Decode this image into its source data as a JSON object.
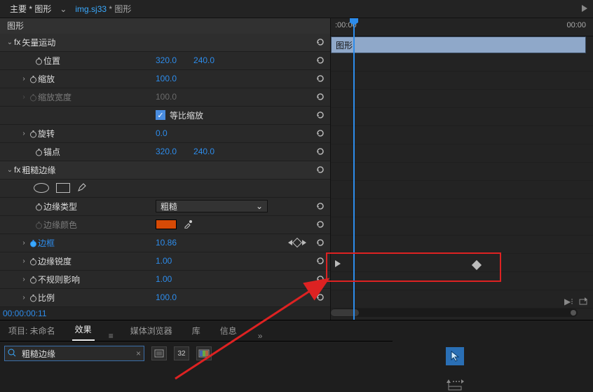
{
  "tabs": {
    "main_prefix": "主要",
    "main_star": "*",
    "main_label": "图形",
    "file_name": "img.sj33",
    "file_suffix": "* 图形"
  },
  "left_header": "图形",
  "timecodes": {
    "t0": ":00:00",
    "t1": "00:00"
  },
  "clip_label": "图形",
  "groups": {
    "vector_motion": "矢量运动",
    "roughen_edges": "粗糙边缘"
  },
  "props": {
    "position": {
      "label": "位置",
      "x": "320.0",
      "y": "240.0"
    },
    "scale": {
      "label": "缩放",
      "v": "100.0"
    },
    "scale_width": {
      "label": "缩放宽度",
      "v": "100.0"
    },
    "uniform": {
      "label": "等比缩放"
    },
    "rotation": {
      "label": "旋转",
      "v": "0.0"
    },
    "anchor": {
      "label": "锚点",
      "x": "320.0",
      "y": "240.0"
    },
    "edge_type": {
      "label": "边缘类型",
      "v": "粗糙"
    },
    "edge_color": {
      "label": "边缘颜色"
    },
    "border": {
      "label": "边框",
      "v": "10.86"
    },
    "edge_sharp": {
      "label": "边缘锐度",
      "v": "1.00"
    },
    "irregular": {
      "label": "不规则影响",
      "v": "1.00"
    },
    "ratio": {
      "label": "比例",
      "v": "100.0"
    }
  },
  "timecode": "00:00:00:11",
  "bottom_tabs": {
    "project": "项目: 未命名",
    "effects": "效果",
    "media": "媒体浏览器",
    "library": "库",
    "info": "信息"
  },
  "search": {
    "value": "粗糙边缘"
  },
  "icons": {
    "num32": "32"
  }
}
